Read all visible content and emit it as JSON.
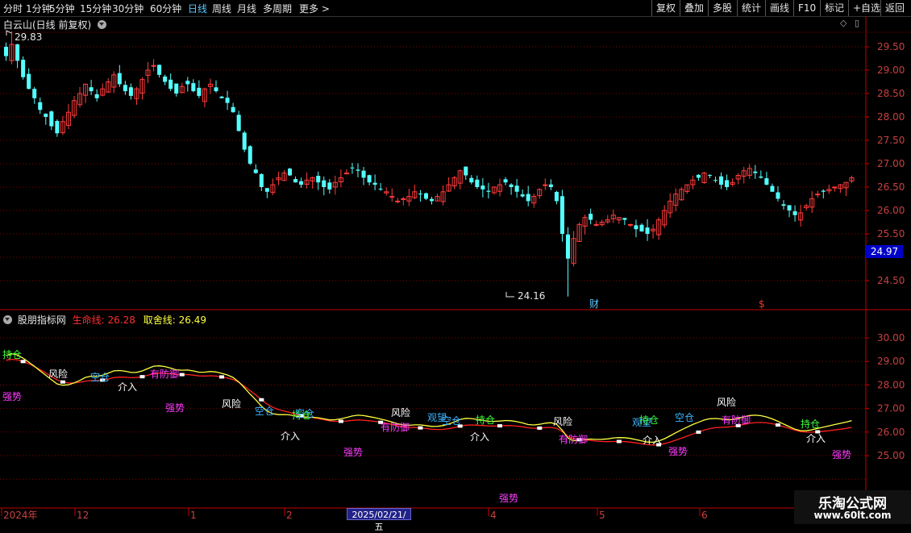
{
  "toolbar": {
    "periods": [
      "分时",
      "1分钟",
      "5分钟",
      "15分钟",
      "30分钟",
      "60分钟",
      "日线",
      "周线",
      "月线",
      "多周期",
      "更多"
    ],
    "selected": "日线",
    "right_buttons": [
      "复权",
      "叠加",
      "多股",
      "统计",
      "画线",
      "F10",
      "标记",
      "+自选",
      "返回"
    ]
  },
  "main_chart": {
    "title": "白云山(日线 前复权)",
    "y_ticks": [
      "29.50",
      "29.00",
      "28.50",
      "28.00",
      "27.50",
      "27.00",
      "26.50",
      "26.00",
      "25.50",
      "24.50"
    ],
    "current_price_tag": "24.97",
    "high_label": "29.83",
    "low_label": "24.16",
    "event_markers": [
      {
        "text": "财",
        "color": "#5cc8ff"
      },
      {
        "text": "$",
        "color": "#ff3030"
      }
    ]
  },
  "indicator": {
    "name": "股朋指标网",
    "line1_label": "生命线:",
    "line1_value": "26.28",
    "line2_label": "取舍线:",
    "line2_value": "26.49",
    "y_ticks": [
      "30.00",
      "29.00",
      "28.00",
      "27.00",
      "26.00",
      "25.00"
    ],
    "signals": [
      {
        "text": "持仓",
        "color": "#3cff3c"
      },
      {
        "text": "强势",
        "color": "#ff3cff"
      },
      {
        "text": "风险",
        "color": "#ffffff"
      },
      {
        "text": "空仓",
        "color": "#3cb4ff"
      },
      {
        "text": "有防御",
        "color": "#ff3cff"
      },
      {
        "text": "介入",
        "color": "#ffffff"
      },
      {
        "text": "强势",
        "color": "#ff3cff"
      },
      {
        "text": "风险",
        "color": "#ffffff"
      },
      {
        "text": "空仓",
        "color": "#3cb4ff"
      },
      {
        "text": "持仓",
        "color": "#3cff3c"
      },
      {
        "text": "空仓",
        "color": "#3cb4ff"
      },
      {
        "text": "介入",
        "color": "#ffffff"
      },
      {
        "text": "强势",
        "color": "#ff3cff"
      },
      {
        "text": "风险",
        "color": "#ffffff"
      },
      {
        "text": "有防御",
        "color": "#ff3cff"
      },
      {
        "text": "观望",
        "color": "#3cb4ff"
      },
      {
        "text": "空仓",
        "color": "#3cb4ff"
      },
      {
        "text": "持仓",
        "color": "#3cff3c"
      },
      {
        "text": "介入",
        "color": "#ffffff"
      },
      {
        "text": "强势",
        "color": "#ff3cff"
      },
      {
        "text": "风险",
        "color": "#ffffff"
      },
      {
        "text": "有防御",
        "color": "#ff3cff"
      },
      {
        "text": "观望",
        "color": "#3cb4ff"
      },
      {
        "text": "持仓",
        "color": "#3cff3c"
      },
      {
        "text": "介入",
        "color": "#ffffff"
      },
      {
        "text": "强势",
        "color": "#ff3cff"
      },
      {
        "text": "空仓",
        "color": "#3cb4ff"
      },
      {
        "text": "风险",
        "color": "#ffffff"
      },
      {
        "text": "有防御",
        "color": "#ff3cff"
      },
      {
        "text": "持仓",
        "color": "#3cff3c"
      },
      {
        "text": "介入",
        "color": "#ffffff"
      },
      {
        "text": "强势",
        "color": "#ff3cff"
      }
    ]
  },
  "time_axis": {
    "labels": [
      "2024年",
      "12",
      "1",
      "2",
      "4",
      "5",
      "6"
    ],
    "cursor_date": "2025/02/21/五"
  },
  "watermark": {
    "title": "乐淘公式网",
    "url": "www.60lt.com"
  },
  "colors": {
    "up": "#ff3c3c",
    "down": "#54ffff",
    "grid": "#8b0000",
    "axis": "#c00000",
    "life": "#ff2020",
    "choice": "#ffff40"
  },
  "chart_data": {
    "type": "candlestick",
    "title": "白云山(日线 前复权)",
    "ylim": [
      24.16,
      29.83
    ],
    "closes": [
      29.3,
      29.55,
      29.2,
      28.85,
      28.6,
      28.4,
      28.15,
      28.0,
      27.8,
      27.65,
      27.9,
      28.1,
      28.35,
      28.5,
      28.7,
      28.55,
      28.4,
      28.6,
      28.75,
      28.9,
      28.7,
      28.55,
      28.45,
      28.6,
      28.8,
      29.0,
      29.1,
      28.9,
      28.75,
      28.6,
      28.5,
      28.65,
      28.7,
      28.55,
      28.45,
      28.6,
      28.7,
      28.55,
      28.4,
      28.3,
      28.1,
      27.7,
      27.3,
      27.0,
      26.8,
      26.5,
      26.4,
      26.55,
      26.7,
      26.8,
      26.75,
      26.6,
      26.55,
      26.65,
      26.7,
      26.6,
      26.5,
      26.45,
      26.6,
      26.7,
      26.8,
      26.9,
      26.85,
      26.7,
      26.6,
      26.55,
      26.45,
      26.4,
      26.3,
      26.2,
      26.25,
      26.3,
      26.4,
      26.35,
      26.25,
      26.2,
      26.3,
      26.4,
      26.55,
      26.7,
      26.85,
      26.75,
      26.6,
      26.5,
      26.45,
      26.4,
      26.5,
      26.55,
      26.6,
      26.5,
      26.4,
      26.3,
      26.2,
      26.3,
      26.45,
      26.55,
      26.5,
      26.2,
      25.5,
      24.97,
      25.4,
      25.7,
      25.85,
      25.8,
      25.7,
      25.75,
      25.8,
      25.9,
      25.85,
      25.8,
      25.7,
      25.6,
      25.55,
      25.5,
      25.6,
      25.8,
      26.0,
      26.2,
      26.35,
      26.45,
      26.55,
      26.65,
      26.7,
      26.8,
      26.75,
      26.65,
      26.55,
      26.5,
      26.6,
      26.75,
      26.85,
      26.9,
      26.8,
      26.7,
      26.55,
      26.4,
      26.25,
      26.1,
      26.0,
      25.9,
      25.95,
      26.1,
      26.25,
      26.35,
      26.4,
      26.45,
      26.5,
      26.55,
      26.6,
      26.7
    ]
  }
}
